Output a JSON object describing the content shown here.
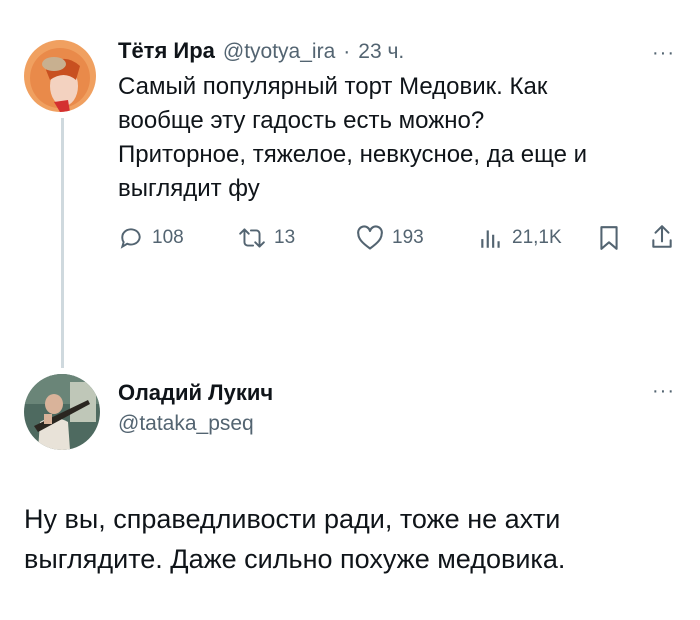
{
  "tweet": {
    "author_name": "Тётя Ира",
    "handle": "@tyotya_ira",
    "separator": "·",
    "time": "23 ч.",
    "text_lines": [
      "Самый популярный торт Медовик. Как",
      "вообще эту гадость есть можно?",
      "Приторное, тяжелое, невкусное, да еще и",
      "выглядит фу"
    ],
    "actions": {
      "replies": "108",
      "retweets": "13",
      "likes": "193",
      "views": "21,1K"
    },
    "icons": [
      "reply-icon",
      "retweet-icon",
      "like-icon",
      "views-icon",
      "bookmark-icon",
      "share-icon"
    ]
  },
  "reply": {
    "author_name": "Оладий Лукич",
    "handle": "@tataka_pseq",
    "text_lines": [
      "Ну вы, справедливости ради, тоже не ахти",
      "выглядите. Даже сильно похуже медовика."
    ]
  },
  "more_label": "···"
}
